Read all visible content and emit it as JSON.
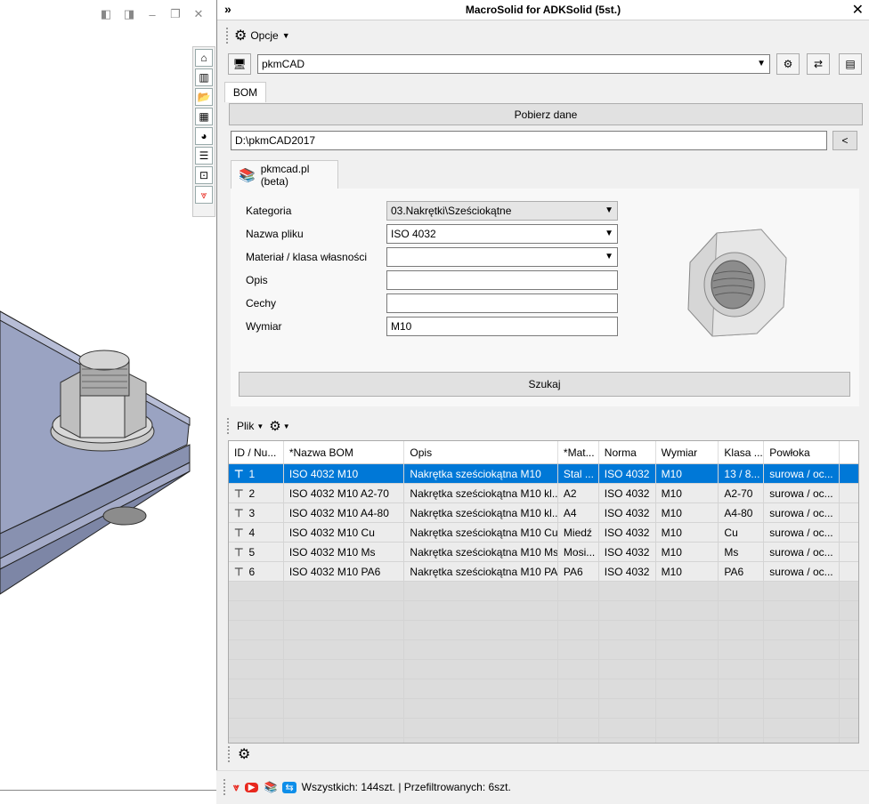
{
  "panel": {
    "title": "MacroSolid for ADKSolid (5st.)",
    "collapse_glyph": "»",
    "close_glyph": "✕"
  },
  "toolbar": {
    "opcje_label": "Opcje"
  },
  "server": {
    "value": "pkmCAD"
  },
  "tabs": {
    "bom": "BOM",
    "pkmcad": "pkmcad.pl (beta)"
  },
  "actions": {
    "pobierz": "Pobierz dane",
    "browse": "<",
    "szukaj": "Szukaj"
  },
  "path": {
    "value": "D:\\pkmCAD2017"
  },
  "form": {
    "kategoria_label": "Kategoria",
    "kategoria_value": "03.Nakrętki\\Sześciokątne",
    "nazwa_label": "Nazwa pliku",
    "nazwa_value": "ISO 4032",
    "material_label": "Materiał / klasa własności",
    "material_value": "",
    "opis_label": "Opis",
    "opis_value": "",
    "cechy_label": "Cechy",
    "cechy_value": "",
    "wymiar_label": "Wymiar",
    "wymiar_value": "M10"
  },
  "grid_toolbar": {
    "plik": "Plik"
  },
  "table": {
    "headers": [
      "ID / Nu...",
      "*Nazwa BOM",
      "Opis",
      "*Mat...",
      "Norma",
      "Wymiar",
      "Klasa ...",
      "Powłoka",
      ""
    ],
    "rows": [
      [
        "1",
        "ISO 4032 M10",
        "Nakrętka sześciokątna M10",
        "Stal ...",
        "ISO 4032",
        "M10",
        "13 / 8...",
        "surowa / oc..."
      ],
      [
        "2",
        "ISO 4032 M10 A2-70",
        "Nakrętka sześciokątna M10 kl...",
        "A2",
        "ISO 4032",
        "M10",
        "A2-70",
        "surowa / oc..."
      ],
      [
        "3",
        "ISO 4032 M10 A4-80",
        "Nakrętka sześciokątna M10 kl...",
        "A4",
        "ISO 4032",
        "M10",
        "A4-80",
        "surowa / oc..."
      ],
      [
        "4",
        "ISO 4032 M10 Cu",
        "Nakrętka sześciokątna M10 Cu",
        "Miedź",
        "ISO 4032",
        "M10",
        "Cu",
        "surowa / oc..."
      ],
      [
        "5",
        "ISO 4032 M10 Ms",
        "Nakrętka sześciokątna M10 Ms",
        "Mosi...",
        "ISO 4032",
        "M10",
        "Ms",
        "surowa / oc..."
      ],
      [
        "6",
        "ISO 4032 M10 PA6",
        "Nakrętka sześciokątna M10 PA6",
        "PA6",
        "ISO 4032",
        "M10",
        "PA6",
        "surowa / oc..."
      ]
    ]
  },
  "status": {
    "text": "Wszystkich: 144szt. | Przefiltrowanych: 6szt."
  },
  "colors": {
    "selection": "#0078d7",
    "accent_red": "#e8281e",
    "accent_orange": "#f39c12"
  }
}
